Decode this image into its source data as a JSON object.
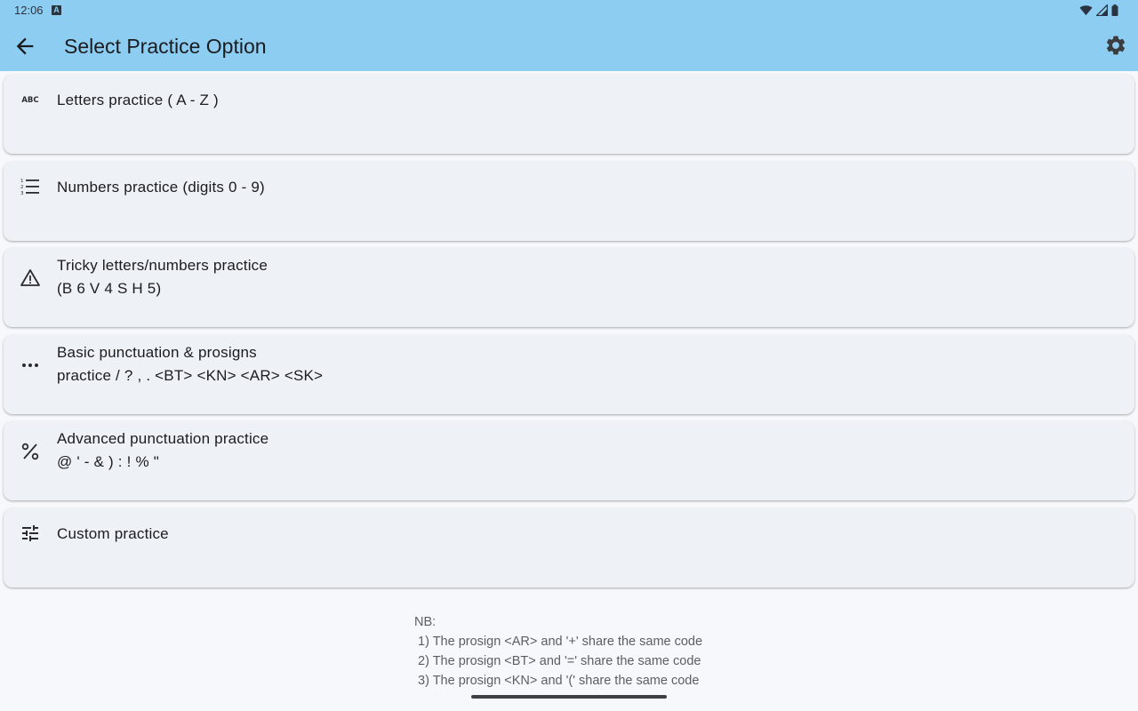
{
  "status": {
    "time": "12:06",
    "notif_glyph": "A"
  },
  "appbar": {
    "title": "Select Practice Option"
  },
  "options": [
    {
      "icon": "abc-icon",
      "line1": "Letters practice ( A - Z )",
      "line2": ""
    },
    {
      "icon": "numbered-list-icon",
      "line1": "Numbers practice (digits 0 - 9)",
      "line2": ""
    },
    {
      "icon": "warning-icon",
      "line1": "Tricky letters/numbers practice",
      "line2": "(B 6 V 4 S H 5)"
    },
    {
      "icon": "more-horiz-icon",
      "line1": "Basic punctuation & prosigns",
      "line2": "practice / ? , . <BT> <KN> <AR> <SK>"
    },
    {
      "icon": "percent-icon",
      "line1": "Advanced punctuation practice",
      "line2": "@ ' - & ) : ! % \""
    },
    {
      "icon": "tune-icon",
      "line1": "Custom practice",
      "line2": ""
    }
  ],
  "notes": {
    "heading": "NB:",
    "lines": [
      " 1) The prosign <AR> and '+' share the same code",
      " 2) The prosign <BT> and '=' share the same code",
      " 3) The prosign <KN> and '(' share the same code"
    ]
  },
  "colors": {
    "appbar": "#8ecdf2",
    "card": "#eef1f6",
    "background": "#f6f8fb"
  }
}
